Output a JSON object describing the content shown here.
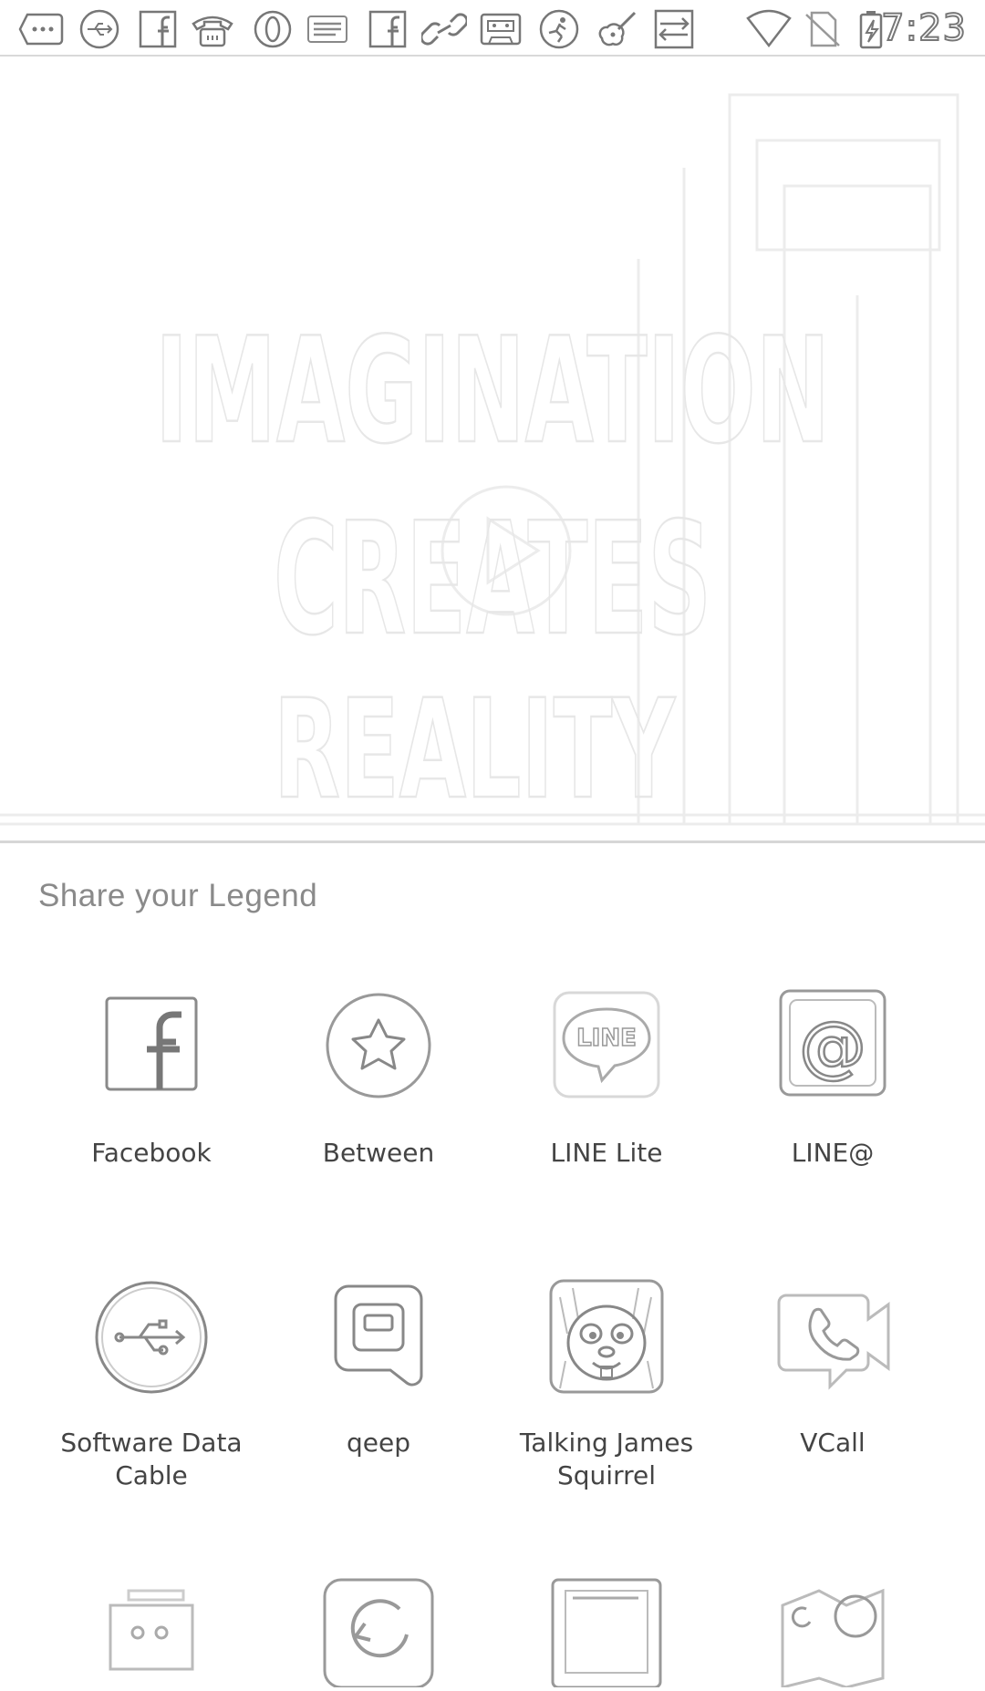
{
  "status_bar": {
    "time": "7:23",
    "notification_icons": [
      "more-icon",
      "usb-icon",
      "facebook-icon",
      "phone-icon",
      "opera-icon",
      "usa-today-icon",
      "facebook-icon",
      "link-icon",
      "cassette-icon",
      "soccer-icon",
      "guitar-icon",
      "transfer-icon"
    ],
    "system_icons": [
      "wifi-icon",
      "no-sim-icon",
      "battery-charging-icon"
    ]
  },
  "backdrop": {
    "poster_lines": [
      "IMAGINATION",
      "CREATES",
      "REALITY"
    ]
  },
  "share_sheet": {
    "title": "Share your Legend",
    "apps": [
      {
        "label": "Facebook",
        "icon": "facebook-icon"
      },
      {
        "label": "Between",
        "icon": "between-icon"
      },
      {
        "label": "LINE Lite",
        "icon": "line-lite-icon",
        "icon_text": "LINE"
      },
      {
        "label": "LINE@",
        "icon": "line-at-icon",
        "icon_text": "@"
      },
      {
        "label": "Software Data Cable",
        "icon": "usb-icon"
      },
      {
        "label": "qeep",
        "icon": "qeep-icon"
      },
      {
        "label": "Talking James Squirrel",
        "icon": "squirrel-icon"
      },
      {
        "label": "VCall",
        "icon": "vcall-icon"
      }
    ]
  }
}
